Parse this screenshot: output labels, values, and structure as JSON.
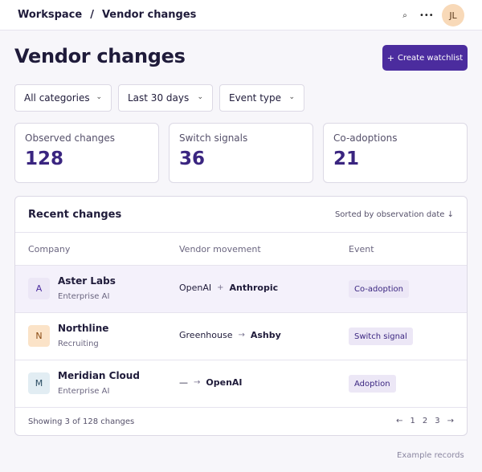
{
  "topbar": {
    "breadcrumb": [
      "Workspace",
      "Vendor changes"
    ],
    "separator": "/",
    "search_icon": "⌕",
    "more_icon": "•••",
    "avatar_initials": "JL"
  },
  "header": {
    "title": "Vendor changes",
    "create_button": {
      "icon": "+",
      "label": "Create watchlist"
    }
  },
  "filters": [
    {
      "value": "All categories",
      "chevron": "⌄"
    },
    {
      "value": "Last 30 days",
      "chevron": "⌄"
    },
    {
      "value": "Event type",
      "chevron": "⌄"
    }
  ],
  "stats": [
    {
      "label": "Observed changes",
      "value": "128"
    },
    {
      "label": "Switch signals",
      "value": "36"
    },
    {
      "label": "Co-adoptions",
      "value": "21"
    }
  ],
  "table": {
    "title": "Recent changes",
    "sort_label": "Sorted by observation date ↓",
    "columns": [
      "Company",
      "Vendor movement",
      "Event"
    ],
    "rows": [
      {
        "initial": "A",
        "company": "Aster Labs",
        "category": "Enterprise AI",
        "from": "OpenAI",
        "connector": "+",
        "to": "Anthropic",
        "event": "Co-adoption",
        "avatar_bg": "#ece7f6",
        "avatar_fg": "#4b2c9e",
        "selected": true
      },
      {
        "initial": "N",
        "company": "Northline",
        "category": "Recruiting",
        "from": "Greenhouse",
        "connector": "→",
        "to": "Ashby",
        "event": "Switch signal",
        "avatar_bg": "#fbe3c8",
        "avatar_fg": "#8a4a12",
        "selected": false
      },
      {
        "initial": "M",
        "company": "Meridian Cloud",
        "category": "Enterprise AI",
        "from": "—",
        "connector": "→",
        "to": "OpenAI",
        "event": "Adoption",
        "avatar_bg": "#e2edf3",
        "avatar_fg": "#2b4d63",
        "selected": false
      }
    ],
    "footer_summary": "Showing 3 of 128 changes",
    "pager": {
      "prev": "←",
      "pages": [
        "1",
        "2",
        "3"
      ],
      "next": "→"
    }
  },
  "footnote": "Example records",
  "colors": {
    "accent": "#4b2c9e",
    "stat_value": "#3a2580",
    "selected_row": "#f4f1fb"
  }
}
